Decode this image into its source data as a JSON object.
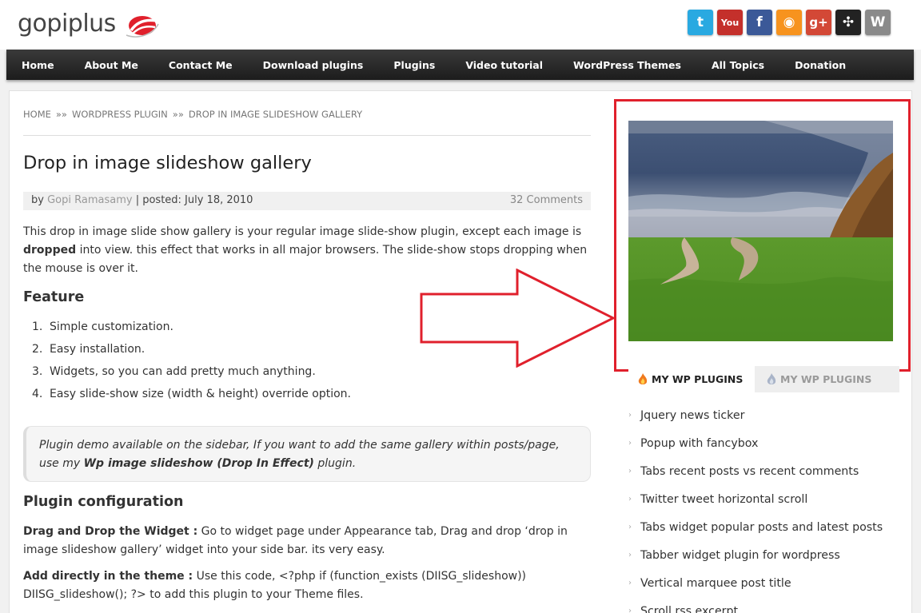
{
  "site": {
    "logo_text": "gopiplus"
  },
  "social": [
    {
      "icon": "twitter-icon",
      "glyph": "t",
      "color": "#29a9e1"
    },
    {
      "icon": "youtube-icon",
      "glyph": "You",
      "color": "#c4302b"
    },
    {
      "icon": "facebook-icon",
      "glyph": "f",
      "color": "#3b5998"
    },
    {
      "icon": "rss-icon",
      "glyph": "◉",
      "color": "#f7931e"
    },
    {
      "icon": "google-plus-icon",
      "glyph": "g+",
      "color": "#d34836"
    },
    {
      "icon": "joomla-icon",
      "glyph": "✣",
      "color": "#222222"
    },
    {
      "icon": "wordpress-icon",
      "glyph": "W",
      "color": "#8a8a8a"
    }
  ],
  "nav": {
    "items": [
      "Home",
      "About Me",
      "Contact Me",
      "Download plugins",
      "Plugins",
      "Video tutorial",
      "WordPress Themes",
      "All Topics",
      "Donation"
    ]
  },
  "breadcrumb": {
    "items": [
      "HOME",
      "WORDPRESS PLUGIN",
      "DROP IN IMAGE SLIDESHOW GALLERY"
    ],
    "separator": "»»"
  },
  "post": {
    "title": "Drop in image slideshow gallery",
    "meta_by": "by",
    "author": "Gopi Ramasamy",
    "meta_posted": "| posted: July 18, 2010",
    "comments": "32 Comments",
    "intro_1": "This drop in image slide show gallery is your regular image slide-show plugin, except each image is",
    "intro_bold": "dropped",
    "intro_2": "into view. this effect that works in all major browsers. The slide-show stops dropping when the mouse is over it.",
    "feature_heading": "Feature",
    "features": [
      "Simple customization.",
      "Easy installation.",
      "Widgets, so you can add pretty much anything.",
      "Easy slide-show size (width & height) override option."
    ],
    "demo_1": "Plugin demo available on the sidebar, If you want to add the same gallery within posts/page, use my",
    "demo_bold": "Wp image slideshow (Drop In Effect)",
    "demo_2": "plugin.",
    "config_heading": "Plugin configuration",
    "drag_lead": "Drag and Drop the Widget :",
    "drag_text": "Go to widget page under Appearance tab, Drag and drop ‘drop in image slideshow gallery’ widget into your side bar. its very easy.",
    "add_lead": "Add directly in the theme :",
    "add_text": "Use this code, <?php if (function_exists (DIISG_slideshow)) DIISG_slideshow(); ?> to add this plugin to your Theme files."
  },
  "sidebar": {
    "tabs": [
      "MY WP PLUGINS",
      "MY WP PLUGINS"
    ],
    "plugins": [
      "Jquery news ticker",
      "Popup with fancybox",
      "Tabs recent posts vs recent comments",
      "Twitter tweet horizontal scroll",
      "Tabs widget popular posts and latest posts",
      "Tabber widget plugin for wordpress",
      "Vertical marquee post title",
      "Scroll rss excerpt"
    ]
  },
  "colors": {
    "highlight": "#e0202c",
    "nav_bg": "#1c1c1c",
    "accent": "#e0202c"
  }
}
